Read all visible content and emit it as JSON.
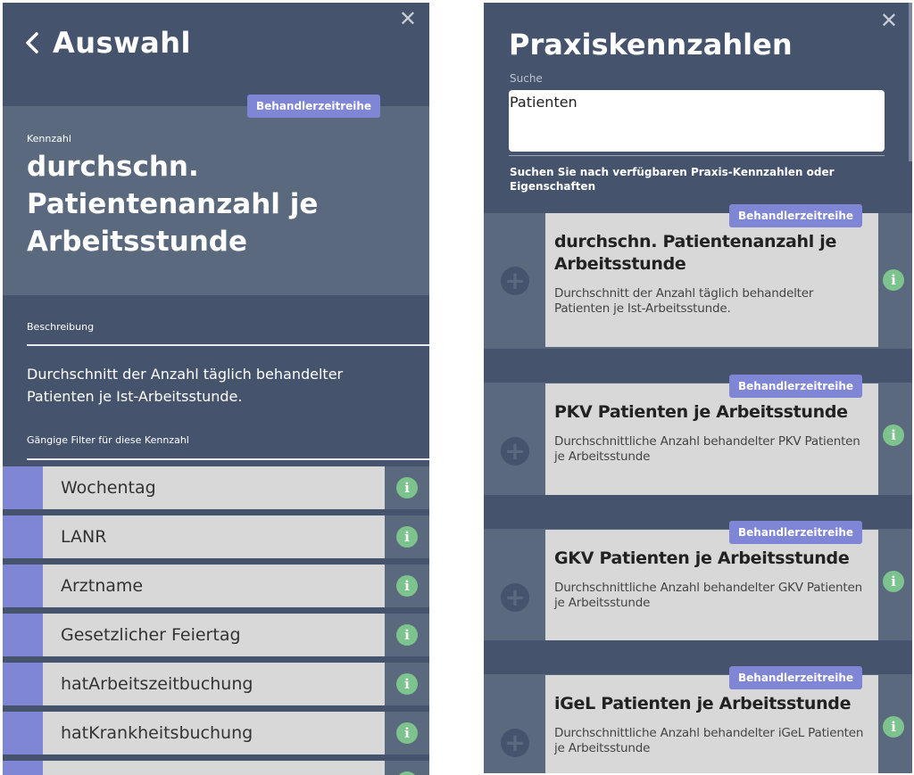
{
  "left_panel": {
    "close_icon": "close-icon",
    "back_icon": "chevron-left-icon",
    "title": "Auswahl",
    "tag": "Behandlerzeitreihe",
    "kennzahl_label": "Kennzahl",
    "kennzahl_title": "durchschn. Patientenanzahl je Arbeitsstunde",
    "description_label": "Beschreibung",
    "description_text": "Durchschnitt der Anzahl täglich behandelter Patienten je Ist-Arbeitsstunde.",
    "filters_label": "Gängige Filter für diese Kennzahl",
    "filters": [
      {
        "label": "Wochentag"
      },
      {
        "label": "LANR"
      },
      {
        "label": "Arztname"
      },
      {
        "label": "Gesetzlicher Feiertag"
      },
      {
        "label": "hatArbeitszeitbuchung"
      },
      {
        "label": "hatKrankheitsbuchung"
      },
      {
        "label": ""
      }
    ]
  },
  "right_panel": {
    "close_icon": "close-icon",
    "title": "Praxiskennzahlen",
    "search_label": "Suche",
    "search_value": "Patienten",
    "hint": "Suchen Sie nach verfügbaren Praxis-Kennzahlen oder Eigenschaften",
    "results": [
      {
        "tag": "Behandlerzeitreihe",
        "title": "durchschn. Patientenanzahl je Arbeitsstunde",
        "description": "Durchschnitt der Anzahl täglich behandelter Patienten je Ist-Arbeitsstunde."
      },
      {
        "tag": "Behandlerzeitreihe",
        "title": "PKV Patienten je Arbeitsstunde",
        "description": "Durchschnittliche Anzahl behandelter PKV Patienten je Arbeitsstunde"
      },
      {
        "tag": "Behandlerzeitreihe",
        "title": "GKV Patienten je Arbeitsstunde",
        "description": "Durchschnittliche Anzahl behandelter GKV Patienten je Arbeitsstunde"
      },
      {
        "tag": "Behandlerzeitreihe",
        "title": "iGeL Patienten je Arbeitsstunde",
        "description": "Durchschnittliche Anzahl behandelter iGeL Patienten je Arbeitsstunde"
      }
    ]
  },
  "colors": {
    "panel_dark": "#45546c",
    "panel_mid": "#5a697e",
    "accent": "#7f86d6",
    "card": "#d8d8d8",
    "info_green": "#7dc38e"
  }
}
